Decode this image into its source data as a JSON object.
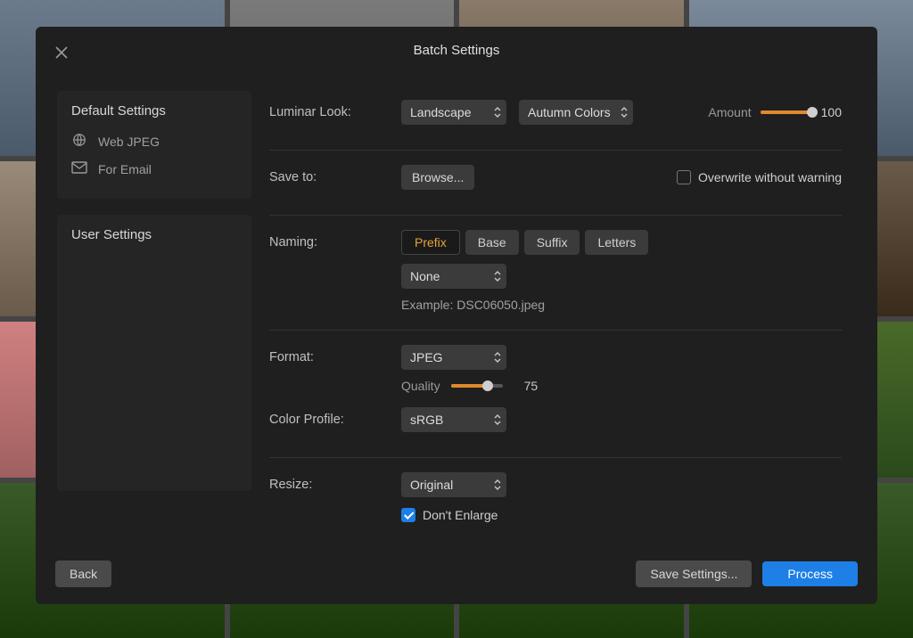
{
  "modal_title": "Batch Settings",
  "sidebar": {
    "default_title": "Default Settings",
    "default_items": [
      {
        "label": "Web JPEG"
      },
      {
        "label": "For Email"
      }
    ],
    "user_title": "User Settings"
  },
  "look": {
    "label": "Luminar Look:",
    "preset": "Landscape",
    "variant": "Autumn Colors",
    "amount_label": "Amount",
    "amount_value": "100"
  },
  "save": {
    "label": "Save to:",
    "browse": "Browse...",
    "overwrite_label": "Overwrite without warning",
    "overwrite_checked": false
  },
  "naming": {
    "label": "Naming:",
    "segments": [
      "Prefix",
      "Base",
      "Suffix",
      "Letters"
    ],
    "active": "Prefix",
    "value": "None",
    "example_label": "Example: DSC06050.jpeg"
  },
  "format": {
    "label": "Format:",
    "value": "JPEG",
    "quality_label": "Quality",
    "quality_value": "75",
    "profile_label": "Color Profile:",
    "profile_value": "sRGB"
  },
  "resize": {
    "label": "Resize:",
    "value": "Original",
    "dont_enlarge_label": "Don't Enlarge",
    "dont_enlarge_checked": true
  },
  "footer": {
    "back": "Back",
    "save_settings": "Save Settings...",
    "process": "Process"
  }
}
